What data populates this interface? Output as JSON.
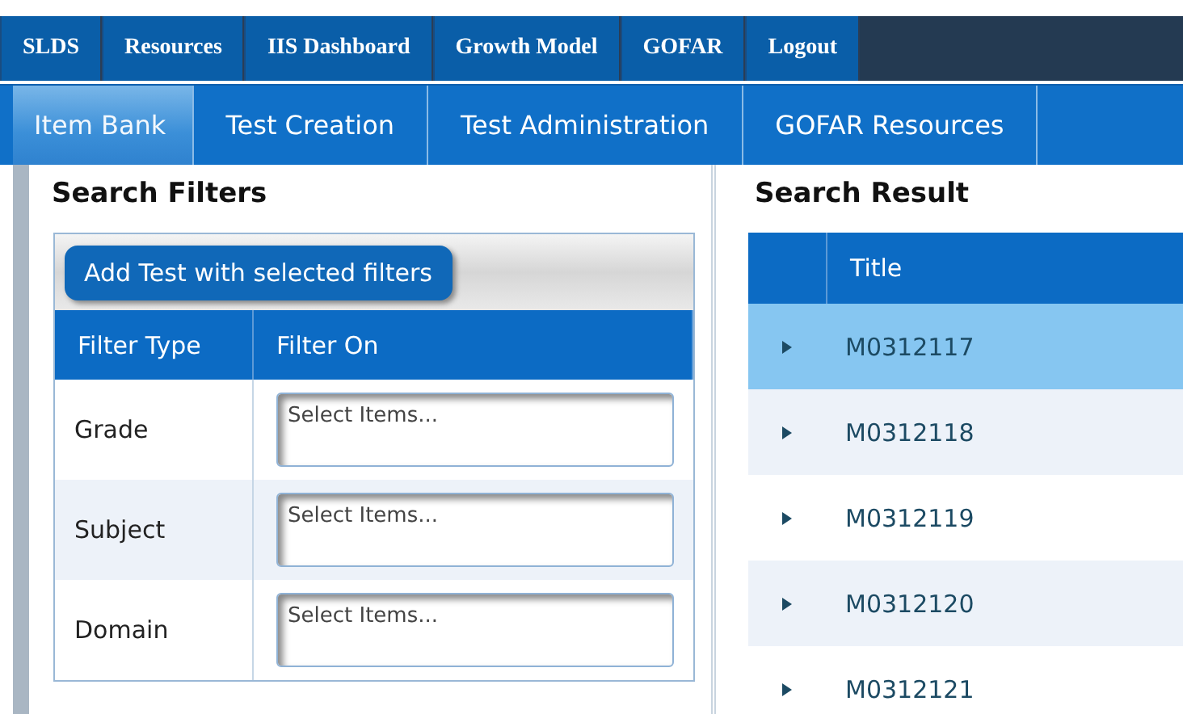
{
  "top_nav": [
    {
      "label": "SLDS"
    },
    {
      "label": "Resources"
    },
    {
      "label": "IIS Dashboard"
    },
    {
      "label": "Growth Model"
    },
    {
      "label": "GOFAR"
    },
    {
      "label": "Logout"
    }
  ],
  "tabs": [
    {
      "label": "Item Bank",
      "selected": true
    },
    {
      "label": "Test Creation",
      "selected": false
    },
    {
      "label": "Test Administration",
      "selected": false
    },
    {
      "label": "GOFAR Resources",
      "selected": false
    }
  ],
  "filters": {
    "title": "Search Filters",
    "add_button": "Add Test with selected filters",
    "columns": [
      "Filter Type",
      "Filter On"
    ],
    "rows": [
      {
        "type": "Grade",
        "placeholder": "Select Items..."
      },
      {
        "type": "Subject",
        "placeholder": "Select Items..."
      },
      {
        "type": "Domain",
        "placeholder": "Select Items..."
      }
    ]
  },
  "results": {
    "title": "Search Result",
    "columns": [
      "Title"
    ],
    "rows": [
      {
        "title": "M0312117",
        "selected": true
      },
      {
        "title": "M0312118",
        "selected": false
      },
      {
        "title": "M0312119",
        "selected": false
      },
      {
        "title": "M0312120",
        "selected": false
      },
      {
        "title": "M0312121",
        "selected": false
      }
    ]
  }
}
